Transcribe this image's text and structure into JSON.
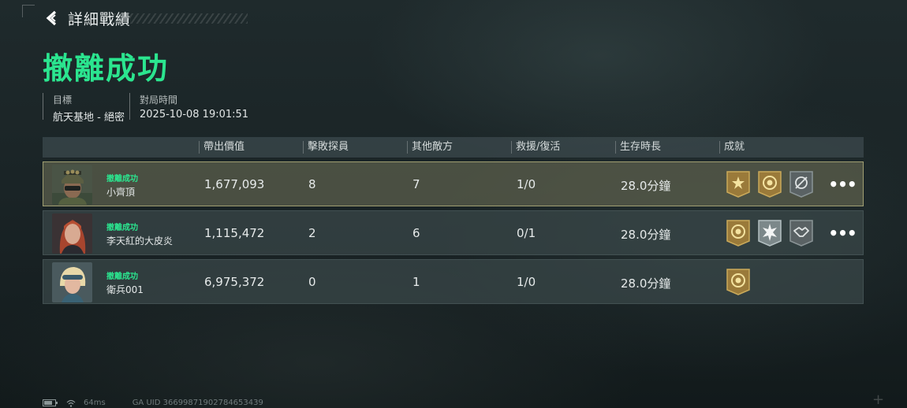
{
  "header": {
    "title": "詳細戰績",
    "back_icon": "chevron-left-icon"
  },
  "result": {
    "title": "撤離成功",
    "color": "#2be58f"
  },
  "info": {
    "target_label": "目標",
    "target_value": "航天基地 - 絕密",
    "time_label": "對局時間",
    "time_value": "2025-10-08 19:01:51"
  },
  "table": {
    "columns": [
      "帶出價值",
      "擊敗探員",
      "其他敵方",
      "救援/復活",
      "生存時長",
      "成就"
    ],
    "rows": [
      {
        "status": "撤離成功",
        "name": "小齊頂",
        "value": "1,677,093",
        "kills": "8",
        "others": "7",
        "rescue": "1/0",
        "survival": "28.0分鐘",
        "highlighted": true,
        "badges": [
          "gold-star-badge",
          "gold-coin-badge",
          "gray-target-badge"
        ]
      },
      {
        "status": "撤離成功",
        "name": "李天紅的大皮炎",
        "value": "1,115,472",
        "kills": "2",
        "others": "6",
        "rescue": "0/1",
        "survival": "28.0分鐘",
        "highlighted": false,
        "badges": [
          "gold-coin-badge",
          "silver-burst-badge",
          "gray-handshake-badge"
        ]
      },
      {
        "status": "撤離成功",
        "name": "衛兵001",
        "value": "6,975,372",
        "kills": "0",
        "others": "1",
        "rescue": "1/0",
        "survival": "28.0分鐘",
        "highlighted": false,
        "badges": [
          "gold-coin-badge"
        ]
      }
    ],
    "more_label": "•••"
  },
  "footer": {
    "battery_icon": "battery-icon",
    "wifi_icon": "wifi-icon",
    "ping": "64ms",
    "uid": "GA UID 3669987190278465343​9"
  }
}
